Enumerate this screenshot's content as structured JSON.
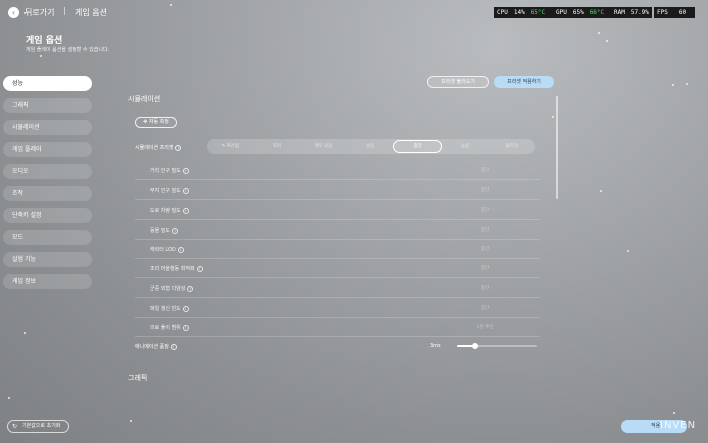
{
  "header": {
    "back_label": "뒤로가기",
    "separator": "|",
    "breadcrumb": "게임 옵션",
    "stats": [
      {
        "label": "CPU",
        "value": "14%",
        "temp": "65°C"
      },
      {
        "label": "GPU",
        "value": "65%",
        "temp": "66°C"
      },
      {
        "label": "RAM",
        "value": "57.9%"
      },
      {
        "label": "FPS",
        "value": "60"
      }
    ]
  },
  "page": {
    "title": "게임 옵션",
    "subtitle": "게임 플레이 옵션을 설정할 수 있습니다."
  },
  "sidebar": {
    "items": [
      {
        "label": "성능",
        "active": true
      },
      {
        "label": "그래픽"
      },
      {
        "label": "시뮬레이션"
      },
      {
        "label": "게임 플레이"
      },
      {
        "label": "오디오"
      },
      {
        "label": "조작"
      },
      {
        "label": "단축키 설정"
      },
      {
        "label": "모드"
      },
      {
        "label": "실험 기능"
      },
      {
        "label": "게임 정보"
      }
    ],
    "reset_label": "기본값으로 초기화"
  },
  "presets": {
    "load_label": "프리셋 불러오기",
    "apply_label": "프리셋 적용하기"
  },
  "simulation": {
    "section_title": "시뮬레이션",
    "auto_detect_label": "자동 측정",
    "preset_label": "시뮬레이션 프리셋",
    "preset_options": [
      "커스텀",
      "최저",
      "매우 낮음",
      "낮음",
      "중간",
      "높음",
      "울트라"
    ],
    "preset_selected": "중간",
    "rows": [
      {
        "label": "거리 인구 밀도",
        "value": "중간"
      },
      {
        "label": "부지 인구 밀도",
        "value": "중간"
      },
      {
        "label": "도로 차량 밀도",
        "value": "중간"
      },
      {
        "label": "동물 밀도",
        "value": "중간"
      },
      {
        "label": "캐릭터 LOD",
        "value": "중간"
      },
      {
        "label": "조리 마을행동 최적화",
        "value": "중간"
      },
      {
        "label": "군중 외형 다양성",
        "value": "중간"
      },
      {
        "label": "파일 갱신 빈도",
        "value": "중간"
      },
      {
        "label": "의료 풀이 범위",
        "value": "1천 주민"
      }
    ],
    "timing_slider": {
      "label": "애니메이션 품질",
      "value": "3ms",
      "fraction": 0.23
    }
  },
  "graphics": {
    "section_title": "그래픽"
  },
  "footer": {
    "apply_label": "적용",
    "watermark": "INVEN"
  }
}
